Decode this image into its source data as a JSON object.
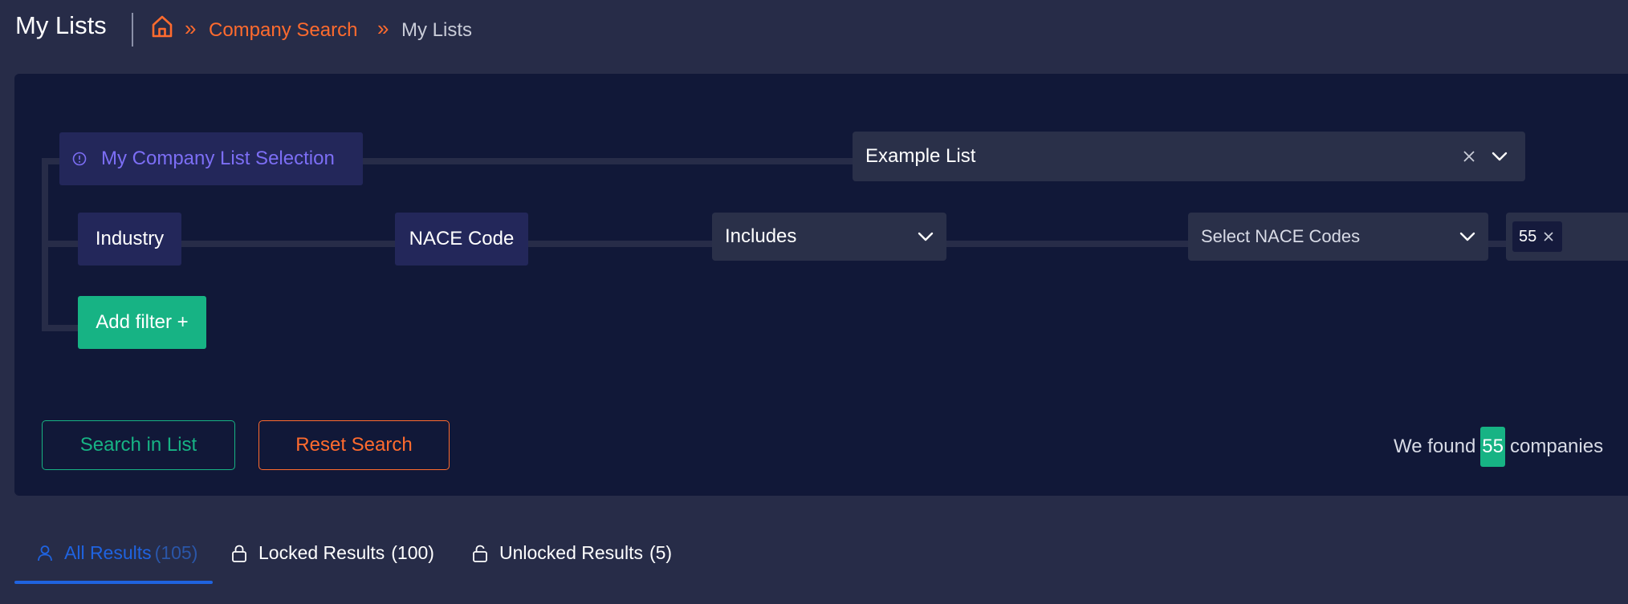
{
  "header": {
    "title": "My Lists",
    "breadcrumb": {
      "separator": "»",
      "link": "Company Search",
      "current": "My Lists"
    }
  },
  "filters": {
    "list_selection_label": "My Company List Selection",
    "list_selected": "Example List",
    "industry_label": "Industry",
    "nace_label": "NACE Code",
    "operator_value": "Includes",
    "nace_placeholder": "Select NACE Codes",
    "selected_code": "55",
    "add_filter_label": "Add filter +"
  },
  "actions": {
    "search_label": "Search in List",
    "reset_label": "Reset Search"
  },
  "results": {
    "found_prefix": "We found",
    "count": "55",
    "found_suffix": "companies"
  },
  "tabs": [
    {
      "label": "All Results",
      "count": "(105)",
      "icon": "user-icon",
      "active": true
    },
    {
      "label": "Locked Results",
      "count": "(100)",
      "icon": "lock-icon",
      "active": false
    },
    {
      "label": "Unlocked Results",
      "count": "(5)",
      "icon": "unlock-icon",
      "active": false
    }
  ],
  "colors": {
    "background": "#272c48",
    "panel": "#111838",
    "accent_orange": "#ff6b2e",
    "accent_green": "#17b384",
    "accent_blue": "#1f63e0",
    "accent_purple": "#7c6ef5"
  }
}
